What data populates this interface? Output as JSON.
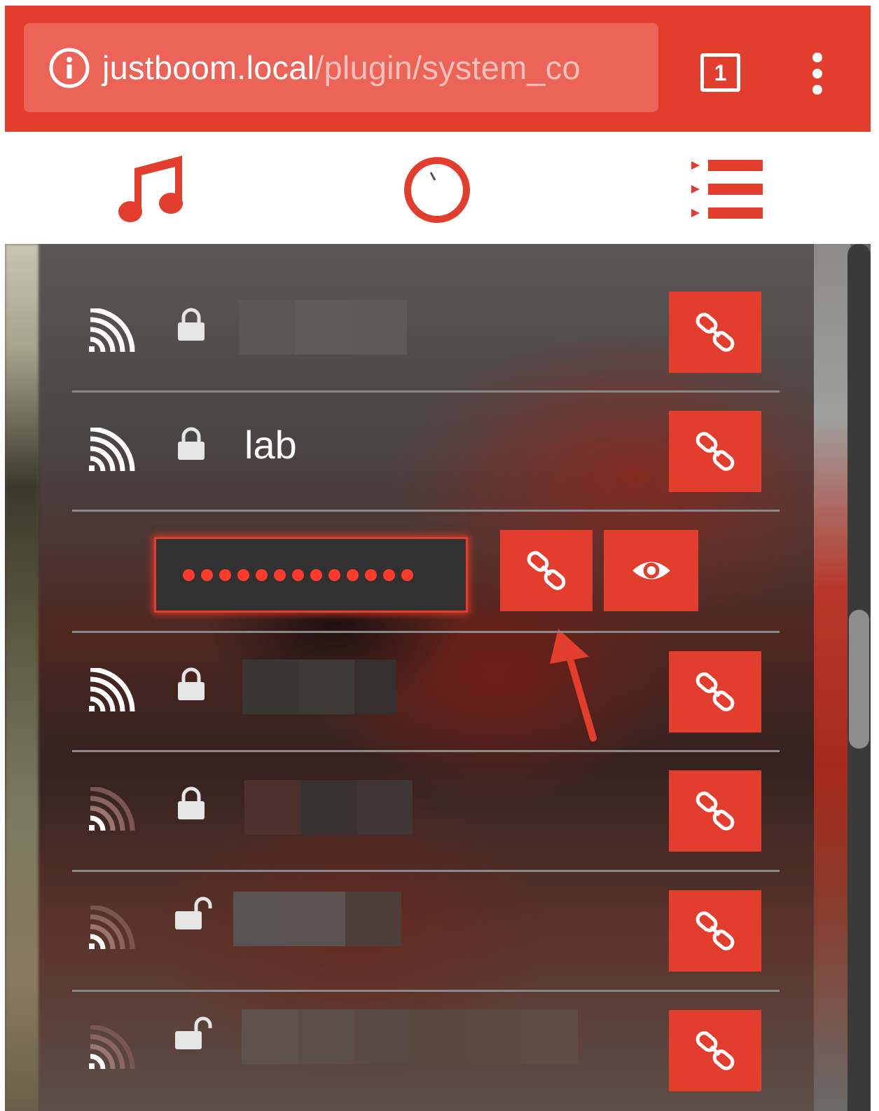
{
  "browser": {
    "url_host": "justboom.local",
    "url_path": "/plugin/system_co",
    "tab_count": "1",
    "accent_color": "#e33d2e"
  },
  "app_nav": {
    "items": [
      {
        "icon": "music-note-icon"
      },
      {
        "icon": "volume-knob-icon"
      },
      {
        "icon": "queue-list-icon"
      }
    ]
  },
  "wifi_list": {
    "networks": [
      {
        "ssid": "",
        "secured": true,
        "signal": "strong"
      },
      {
        "ssid": "lab",
        "secured": true,
        "signal": "strong",
        "expanded": true
      },
      {
        "ssid": "",
        "secured": true,
        "signal": "strong"
      },
      {
        "ssid": "",
        "secured": true,
        "signal": "weak"
      },
      {
        "ssid": "",
        "secured": false,
        "signal": "weak"
      },
      {
        "ssid": "",
        "secured": false,
        "signal": "weak"
      }
    ],
    "password_field": {
      "value": "••••••••••••••",
      "length": 13
    },
    "connect_icon": "link-icon",
    "reveal_icon": "eye-icon"
  }
}
